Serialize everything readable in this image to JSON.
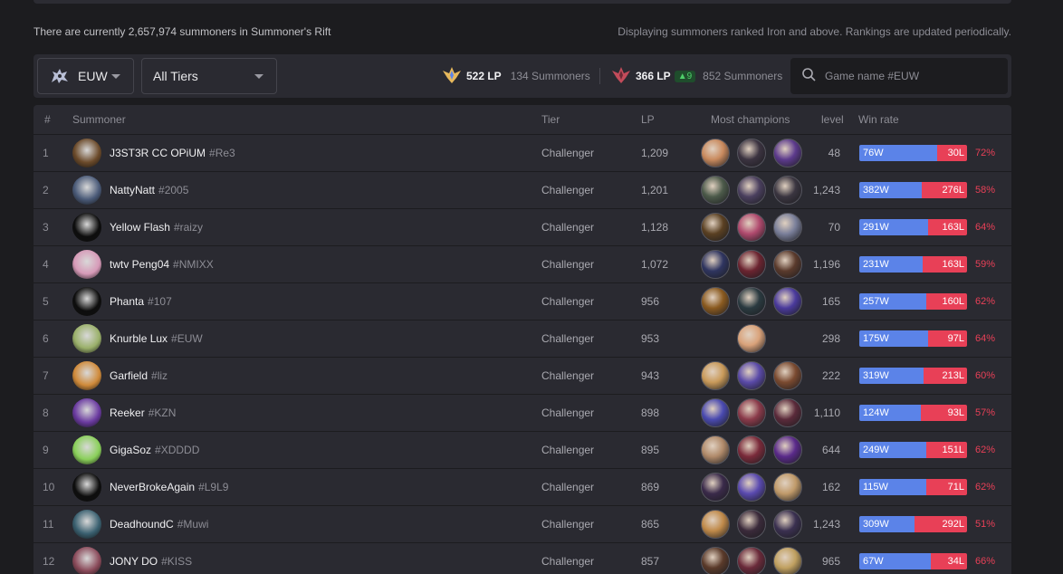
{
  "info": {
    "left": "There are currently 2,657,974 summoners in Summoner's Rift",
    "right": "Displaying summoners ranked Iron and above. Rankings are updated periodically."
  },
  "filters": {
    "region": "EUW",
    "region_icon": "euw-flag-icon",
    "tier": "All Tiers",
    "challenger_lp": "522 LP",
    "challenger_count": "134 Summoners",
    "grandmaster_lp": "366 LP",
    "grandmaster_delta": "▲9",
    "grandmaster_count": "852 Summoners",
    "search_placeholder": "Game name #EUW"
  },
  "colors": {
    "win": "#5b83e8",
    "loss": "#e84057",
    "accent_gold": "#e6b85c",
    "accent_red": "#c24b5a"
  },
  "table": {
    "headers": {
      "rank": "#",
      "summoner": "Summoner",
      "tier": "Tier",
      "lp": "LP",
      "champs": "Most champions",
      "level": "level",
      "winrate": "Win rate"
    },
    "rows": [
      {
        "rank": "1",
        "name": "J3ST3R CC OPiUM",
        "tag": "#Re3",
        "tier": "Challenger",
        "lp": "1,209",
        "level": "48",
        "wins": "76W",
        "losses": "30L",
        "pct": "72%",
        "win_frac": 0.72,
        "avatar": "#6b4a2a",
        "champs": [
          "#c98a5e",
          "#3b3340",
          "#5c3a8c"
        ]
      },
      {
        "rank": "2",
        "name": "NattyNatt",
        "tag": "#2005",
        "tier": "Challenger",
        "lp": "1,201",
        "level": "1,243",
        "wins": "382W",
        "losses": "276L",
        "pct": "58%",
        "win_frac": 0.58,
        "avatar": "#4a5a78",
        "champs": [
          "#4c5a4a",
          "#4a3f5e",
          "#3a3540"
        ]
      },
      {
        "rank": "3",
        "name": "Yellow Flash",
        "tag": "#raizy",
        "tier": "Challenger",
        "lp": "1,128",
        "level": "70",
        "wins": "291W",
        "losses": "163L",
        "pct": "64%",
        "win_frac": 0.64,
        "avatar": "#0d0d0d",
        "champs": [
          "#5a4022",
          "#b04a6e",
          "#7a7f9a"
        ]
      },
      {
        "rank": "4",
        "name": "twtv Peng04",
        "tag": "#NMIXX",
        "tier": "Challenger",
        "lp": "1,072",
        "level": "1,196",
        "wins": "231W",
        "losses": "163L",
        "pct": "59%",
        "win_frac": 0.59,
        "avatar": "#d79ab8",
        "champs": [
          "#2f3560",
          "#6b2430",
          "#5a3a2c"
        ]
      },
      {
        "rank": "5",
        "name": "Phanta",
        "tag": "#107",
        "tier": "Challenger",
        "lp": "956",
        "level": "165",
        "wins": "257W",
        "losses": "160L",
        "pct": "62%",
        "win_frac": 0.62,
        "avatar": "#0d0d0d",
        "champs": [
          "#8a5a20",
          "#2a3a40",
          "#4a3a9c"
        ]
      },
      {
        "rank": "6",
        "name": "Knurble Lux",
        "tag": "#EUW",
        "tier": "Challenger",
        "lp": "953",
        "level": "298",
        "wins": "175W",
        "losses": "97L",
        "pct": "64%",
        "win_frac": 0.64,
        "avatar": "#9ab06a",
        "champs": [
          "#d9a27a"
        ]
      },
      {
        "rank": "7",
        "name": "Garfield",
        "tag": "#liz",
        "tier": "Challenger",
        "lp": "943",
        "level": "222",
        "wins": "319W",
        "losses": "213L",
        "pct": "60%",
        "win_frac": 0.6,
        "avatar": "#d08a3a",
        "champs": [
          "#c99a5a",
          "#5a4aa8",
          "#7a4a30"
        ]
      },
      {
        "rank": "8",
        "name": "Reeker",
        "tag": "#KZN",
        "tier": "Challenger",
        "lp": "898",
        "level": "1,110",
        "wins": "124W",
        "losses": "93L",
        "pct": "57%",
        "win_frac": 0.57,
        "avatar": "#6a3aa0",
        "champs": [
          "#4a4ab0",
          "#8a3a4a",
          "#5a2a3a"
        ]
      },
      {
        "rank": "9",
        "name": "GigaSoz",
        "tag": "#XDDDD",
        "tier": "Challenger",
        "lp": "895",
        "level": "644",
        "wins": "249W",
        "losses": "151L",
        "pct": "62%",
        "win_frac": 0.62,
        "avatar": "#8ad05a",
        "champs": [
          "#b08a6a",
          "#7a2a3a",
          "#5a2a8a"
        ]
      },
      {
        "rank": "10",
        "name": "NeverBrokeAgain",
        "tag": "#L9L9",
        "tier": "Challenger",
        "lp": "869",
        "level": "162",
        "wins": "115W",
        "losses": "71L",
        "pct": "62%",
        "win_frac": 0.62,
        "avatar": "#0d0d0d",
        "champs": [
          "#3a2a4a",
          "#5a4ab0",
          "#c09a6a"
        ]
      },
      {
        "rank": "11",
        "name": "DeadhoundC",
        "tag": "#Muwi",
        "tier": "Challenger",
        "lp": "865",
        "level": "1,243",
        "wins": "309W",
        "losses": "292L",
        "pct": "51%",
        "win_frac": 0.51,
        "avatar": "#3a6070",
        "champs": [
          "#c08a4a",
          "#3a2a3a",
          "#3a3050"
        ]
      },
      {
        "rank": "12",
        "name": "JONY DO",
        "tag": "#KISS",
        "tier": "Challenger",
        "lp": "857",
        "level": "965",
        "wins": "67W",
        "losses": "34L",
        "pct": "66%",
        "win_frac": 0.66,
        "avatar": "#8a4a5a",
        "champs": [
          "#5a3a2a",
          "#6a2a3a",
          "#c0a060"
        ]
      }
    ]
  }
}
